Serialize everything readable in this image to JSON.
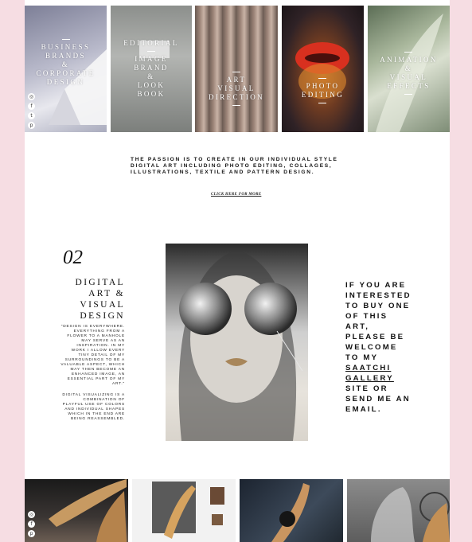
{
  "tiles": [
    {
      "lines": [
        "BUSINESS",
        "BRANDS",
        "&",
        "CORPORATE",
        "DESIGN"
      ]
    },
    {
      "lines": [
        "EDITORIAL",
        "IMAGE",
        "BRAND",
        "&",
        "LOOK",
        "BOOK"
      ]
    },
    {
      "lines": [
        "ART",
        "VISUAL",
        "DIRECTION"
      ]
    },
    {
      "lines": [
        "PHOTO",
        "EDITING"
      ]
    },
    {
      "lines": [
        "ANIMATION",
        "&",
        "VISUAL",
        "EFFECTS"
      ]
    }
  ],
  "social_icons": [
    "instagram-icon",
    "facebook-icon",
    "twitter-icon",
    "pinterest-icon"
  ],
  "passion_lines": [
    "THE PASSION IS TO CREATE IN OUR INDIVIDUAL STYLE",
    "DIGITAL ART INCLUDING PHOTO EDITING, COLLAGES,",
    "ILLUSTRATIONS, TEXTILE AND PATTERN DESIGN."
  ],
  "click_more": "CLICK HERE FOR MORE",
  "section": {
    "number": "02",
    "title_lines": [
      "DIGITAL",
      "ART &",
      "VISUAL",
      "DESIGN"
    ],
    "quote_lines": [
      "\"DESIGN IS EVERYWHERE.",
      "EVERYTHING FROM A",
      "FLOWER TO A MANHOLE",
      "MAY SERVE AS AN",
      "INSPIRATION. IN MY",
      "WORK I ALLOW EVERY",
      "TINY DETAIL OF MY",
      "SURROUNDINGS TO BE A",
      "VALUABLE ASPECT, WHICH",
      "MAY THEN BECOME AN",
      "ENHANCED IMAGE, AN",
      "ESSENTIAL PART OF MY",
      "ART.\""
    ],
    "visual_lines": [
      "DIGITAL VISUALIZING IS A",
      "COMBINATION OF",
      "PLAYFUL USE OF COLORS",
      "AND INDIVIDUAL SHAPES",
      "WHICH IN THE END ARE",
      "BEING REASSEMBLED."
    ]
  },
  "cta": {
    "lines": [
      "IF YOU ARE",
      "INTERESTED",
      "TO BUY ONE",
      "OF THIS",
      "ART,",
      "PLEASE BE",
      "WELCOME",
      "TO MY"
    ],
    "link_lines": [
      "SAATCHI",
      "GALLERY"
    ],
    "after_lines": [
      "SITE OR",
      "SEND ME AN",
      "EMAIL."
    ]
  },
  "colors": {
    "page_bg": "#f6dde3",
    "content_bg": "#ffffff",
    "text": "#111111"
  }
}
